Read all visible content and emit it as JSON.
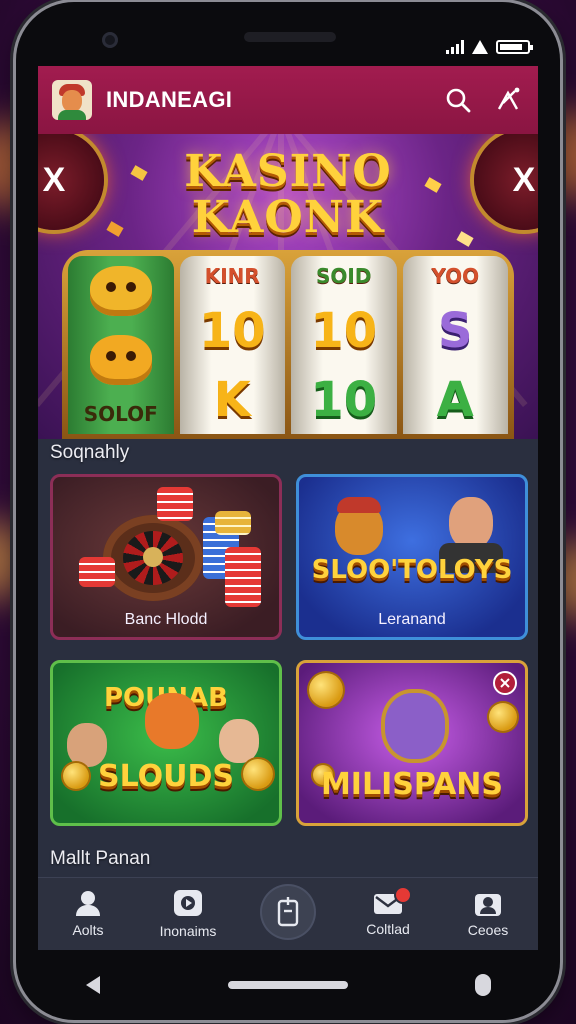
{
  "app": {
    "title": "INDANEAGI"
  },
  "hero": {
    "title_line1": "KASINO",
    "title_line2": "KAONK",
    "reels": [
      {
        "top": "SOLOF",
        "symbols": [
          "blob",
          "blob"
        ],
        "bottom": "SOLOF"
      },
      {
        "top": "KINR",
        "middle": "10",
        "lower": "K"
      },
      {
        "top": "SOID",
        "middle": "10",
        "lower": "10"
      },
      {
        "top": "YOO",
        "middle": "S",
        "lower": "A"
      }
    ]
  },
  "sections": {
    "featured_label": "Soqnahly",
    "more_label": "Mallt Panan"
  },
  "cards": [
    {
      "caption": "Banc Hlodd",
      "art_title": ""
    },
    {
      "caption": "Leranand",
      "art_title": "SLOO'TOLOYS"
    },
    {
      "caption": "",
      "art_title": "SLOUDS",
      "art_top": "POUNAB"
    },
    {
      "caption": "",
      "art_title": "MILISPANS"
    }
  ],
  "tabs": [
    {
      "label": "Aolts",
      "icon": "users-icon"
    },
    {
      "label": "Inonaims",
      "icon": "games-icon"
    },
    {
      "label": "",
      "icon": "center-action-icon"
    },
    {
      "label": "Coltlad",
      "icon": "mail-icon"
    },
    {
      "label": "Ceoes",
      "icon": "profile-icon"
    }
  ],
  "colors": {
    "appbar": "#a21c4f",
    "screen_bg": "#2a2f3f",
    "tabbar": "#2d3140",
    "accent_gold": "#ffd23c"
  }
}
